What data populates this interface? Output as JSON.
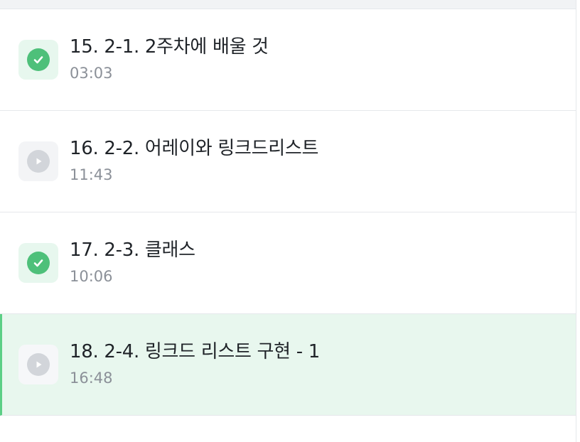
{
  "lessons": [
    {
      "title": "15. 2-1. 2주차에 배울 것",
      "duration": "03:03",
      "status": "completed",
      "active": false
    },
    {
      "title": "16. 2-2. 어레이와 링크드리스트",
      "duration": "11:43",
      "status": "not-started",
      "active": false
    },
    {
      "title": "17. 2-3. 클래스",
      "duration": "10:06",
      "status": "completed",
      "active": false
    },
    {
      "title": "18. 2-4. 링크드 리스트 구현 - 1",
      "duration": "16:48",
      "status": "not-started",
      "active": true
    }
  ],
  "icons": {
    "completed": "check-icon",
    "not_started": "play-icon"
  },
  "colors": {
    "accent_green": "#4ec07a",
    "active_row_bg": "#e8f7ee",
    "pending_icon": "#d2d5da"
  }
}
